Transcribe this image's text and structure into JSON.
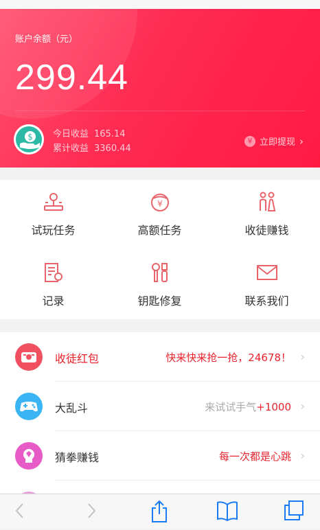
{
  "account": {
    "balance_label": "账户余额（元）",
    "balance": "299.44",
    "today_label": "今日收益",
    "today_value": "165.14",
    "total_label": "累计收益",
    "total_value": "3360.44",
    "withdraw_label": "立即提现",
    "withdraw_icon": "¥"
  },
  "grid": {
    "items": [
      {
        "label": "试玩任务",
        "icon": "joystick-icon"
      },
      {
        "label": "高额任务",
        "icon": "yen-bag-icon"
      },
      {
        "label": "收徒赚钱",
        "icon": "people-icon"
      },
      {
        "label": "记录",
        "icon": "document-icon"
      },
      {
        "label": "钥匙修复",
        "icon": "tools-icon"
      },
      {
        "label": "联系我们",
        "icon": "mail-icon"
      }
    ]
  },
  "list": {
    "items": [
      {
        "title": "收徒红包",
        "subtitle": "快来快来抢一抢，24678！",
        "icon": "red-envelope-icon",
        "icon_color": "#f05060"
      },
      {
        "title": "大乱斗",
        "subtitle_prefix": "来试试手气",
        "subtitle_highlight": "+1000",
        "icon": "gamepad-icon",
        "icon_color": "#3ab4f2"
      },
      {
        "title": "猜拳赚钱",
        "subtitle": "每一次都是心跳",
        "icon": "fist-icon",
        "icon_color": "#e75bc6"
      }
    ]
  },
  "colors": {
    "brand": "#ff2a52",
    "accent_text": "#e8222d",
    "icon_stroke": "#e9646a"
  }
}
